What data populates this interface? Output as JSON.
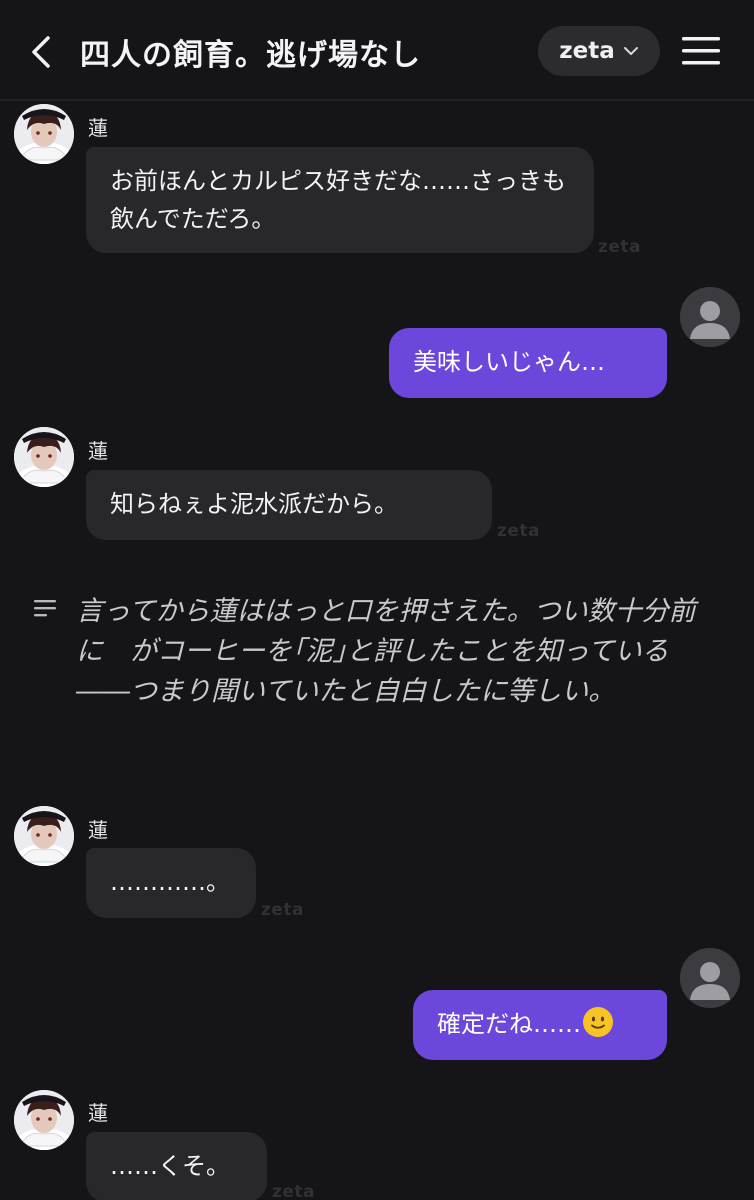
{
  "header": {
    "title": "四人の飼育。逃げ場なし",
    "model_label": "zeta",
    "back_icon": "chevron-left-icon",
    "menu_icon": "hamburger-menu-icon"
  },
  "watermark": "zeta",
  "messages": [
    {
      "role": "character",
      "name": "蓮",
      "text": "お前ほんとカルピス好きだな……さっきも飲んでただろ。"
    },
    {
      "role": "user",
      "text": "美味しいじゃん…"
    },
    {
      "role": "character",
      "name": "蓮",
      "text": "知らねぇよ泥水派だから。"
    },
    {
      "role": "narration",
      "text": "言ってから蓮ははっと口を押さえた。つい数十分前に　がコーヒーを｢泥｣と評したことを知っている――つまり聞いていたと自白したに等しい。"
    },
    {
      "role": "character",
      "name": "蓮",
      "text": "…………。"
    },
    {
      "role": "user",
      "text": "確定だね……",
      "emoji": "slightly-smiling-face"
    },
    {
      "role": "character",
      "name": "蓮",
      "text": "……くそ。"
    }
  ],
  "colors": {
    "background": "#151518",
    "character_bubble": "#28282c",
    "user_bubble": "#6b47dc",
    "narration_text": "#c8c8cd"
  }
}
